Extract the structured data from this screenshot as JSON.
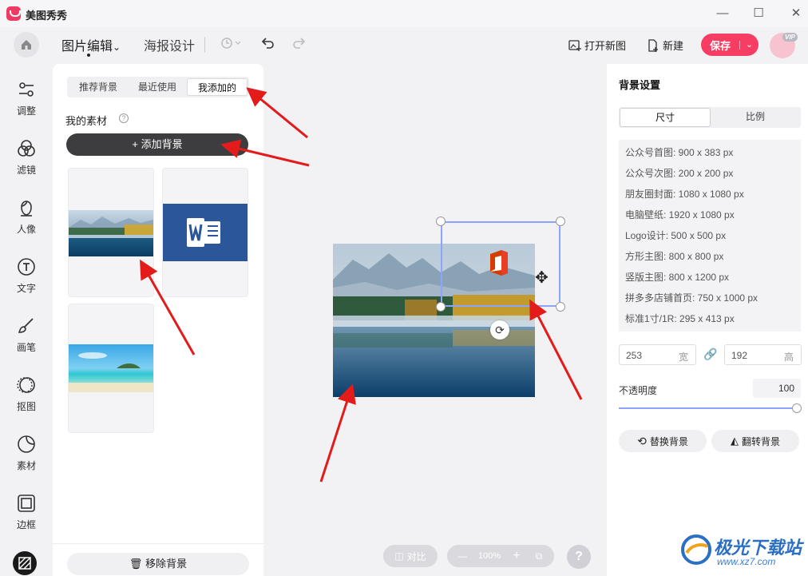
{
  "app": {
    "title": "美图秀秀"
  },
  "window": {
    "minimize": "—",
    "maximize": "☐",
    "close": "✕"
  },
  "toolbar": {
    "tab_edit": "图片编辑",
    "tab_edit_caret": "⌄",
    "tab_poster": "海报设计",
    "open_new_label": "打开新图",
    "new_label": "新建",
    "save_label": "保存",
    "save_dropdown": "⌄",
    "vip_badge": "VIP"
  },
  "rail": [
    {
      "label": "调整",
      "icon": "sliders-icon"
    },
    {
      "label": "滤镜",
      "icon": "filter-icon"
    },
    {
      "label": "人像",
      "icon": "portrait-icon"
    },
    {
      "label": "文字",
      "icon": "text-icon"
    },
    {
      "label": "画笔",
      "icon": "brush-icon"
    },
    {
      "label": "抠图",
      "icon": "cutout-icon"
    },
    {
      "label": "素材",
      "icon": "sticker-icon"
    },
    {
      "label": "边框",
      "icon": "frame-icon"
    }
  ],
  "left_panel": {
    "tabs": [
      "推荐背景",
      "最近使用",
      "我添加的"
    ],
    "active_tab": 2,
    "materials_title": "我的素材",
    "help": "?",
    "add_button": "+ 添加背景",
    "remove_button": "移除背景"
  },
  "canvas": {
    "compare": "对比",
    "zoom": "100%",
    "zoom_out": "—",
    "zoom_in": "+",
    "help": "?"
  },
  "right_panel": {
    "title": "背景设置",
    "tabs": [
      "尺寸",
      "比例"
    ],
    "active_tab": 0,
    "presets": [
      "公众号首图: 900 x 383 px",
      "公众号次图: 200 x 200 px",
      "朋友圈封面: 1080 x 1080 px",
      "电脑壁纸: 1920 x 1080 px",
      "Logo设计: 500 x 500 px",
      "方形主图: 800 x 800 px",
      "竖版主图: 800 x 1200 px",
      "拼多多店铺首页: 750 x 1000 px",
      "标准1寸/1R: 295 x 413 px"
    ],
    "width_value": "253",
    "width_unit": "宽",
    "height_value": "192",
    "height_unit": "高",
    "opacity_label": "不透明度",
    "opacity_value": "100",
    "replace_button": "替换背景",
    "flip_button": "翻转背景"
  },
  "watermark": {
    "title": "极光下载站",
    "url": "www.xz7.com"
  },
  "colors": {
    "accent": "#f73d63",
    "selection": "#8aa4ff",
    "annotation": "#e31b1b"
  }
}
